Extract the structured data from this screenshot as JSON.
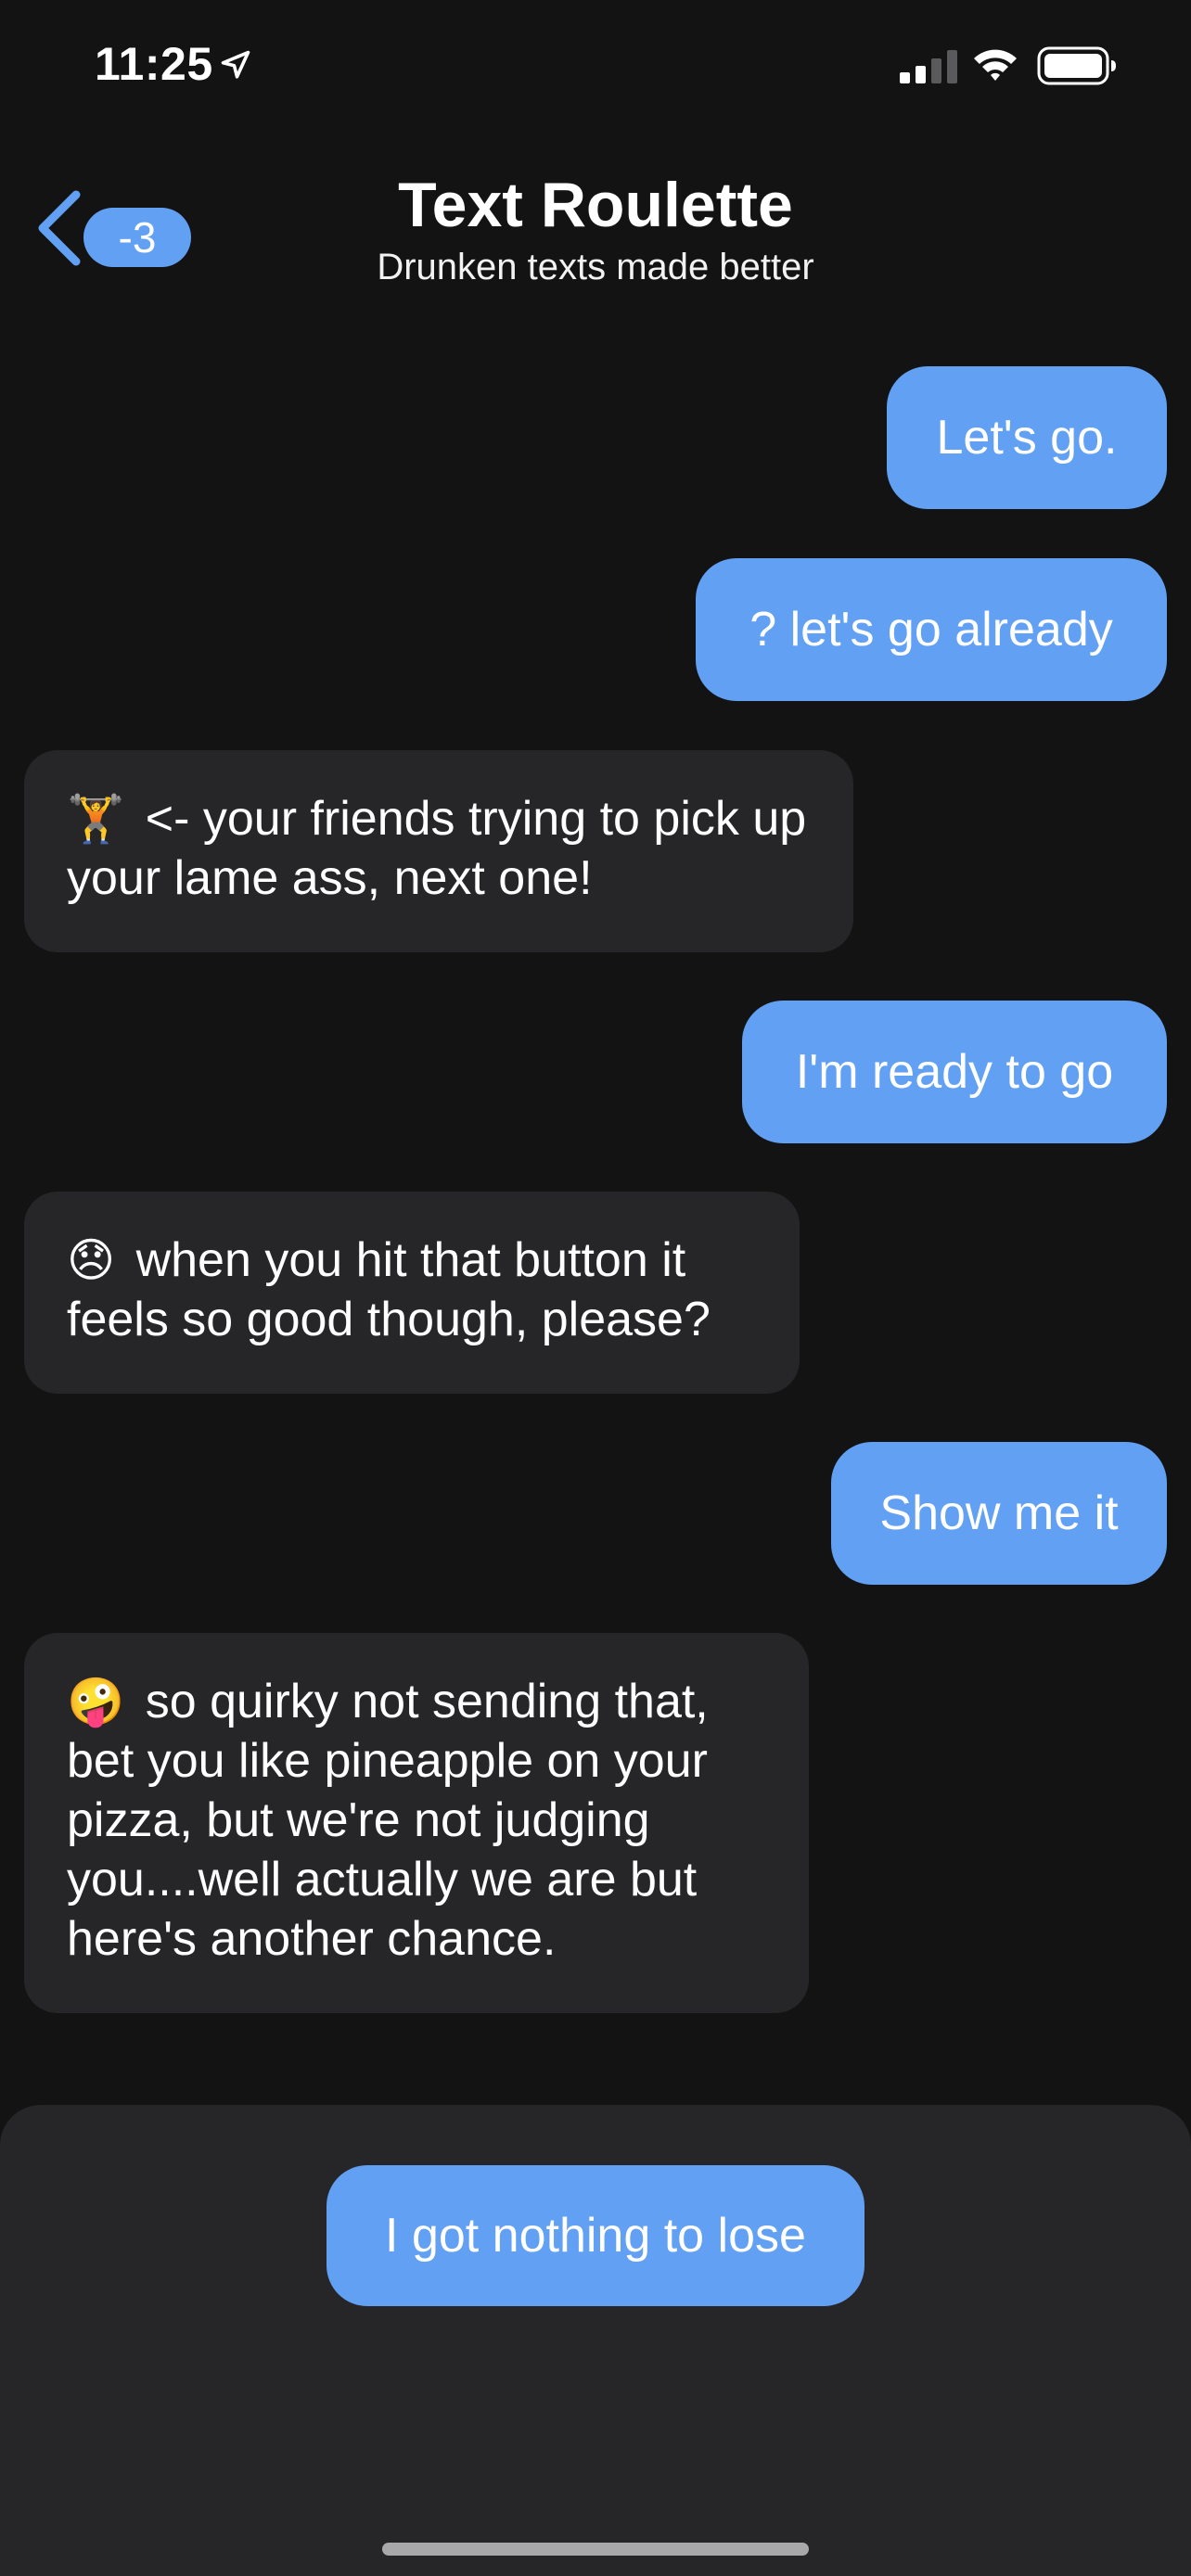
{
  "status_bar": {
    "time": "11:25",
    "icons": [
      "location-arrow-icon",
      "cellular-signal-icon",
      "wifi-icon",
      "battery-icon"
    ]
  },
  "header": {
    "back_badge": "-3",
    "back_icon": "chevron-left-icon",
    "title": "Text Roulette",
    "subtitle": "Drunken texts made better"
  },
  "messages": [
    {
      "side": "sent",
      "text": "Let's go."
    },
    {
      "side": "sent",
      "text": "? let's go already"
    },
    {
      "side": "received",
      "emoji": "🏋️",
      "emoji_name": "weightlifter-emoji",
      "text": "<- your friends trying to pick up your lame ass, next one!"
    },
    {
      "side": "sent",
      "text": "I'm ready to go"
    },
    {
      "side": "received",
      "emoji": "😞",
      "emoji_name": "disappointed-face-emoji",
      "text": "when you hit that button it feels so good though, please?"
    },
    {
      "side": "sent",
      "text": "Show me it"
    },
    {
      "side": "received",
      "emoji": "🤪",
      "emoji_name": "zany-face-emoji",
      "text": "so quirky not sending that, bet you like pineapple on your pizza, but we're not judging you....well actually we are but here's another chance."
    }
  ],
  "reply_option": {
    "label": "I got nothing to lose"
  },
  "colors": {
    "background": "#131314",
    "accent": "#62a0f3",
    "received_bubble": "#262628",
    "panel": "#262628"
  }
}
